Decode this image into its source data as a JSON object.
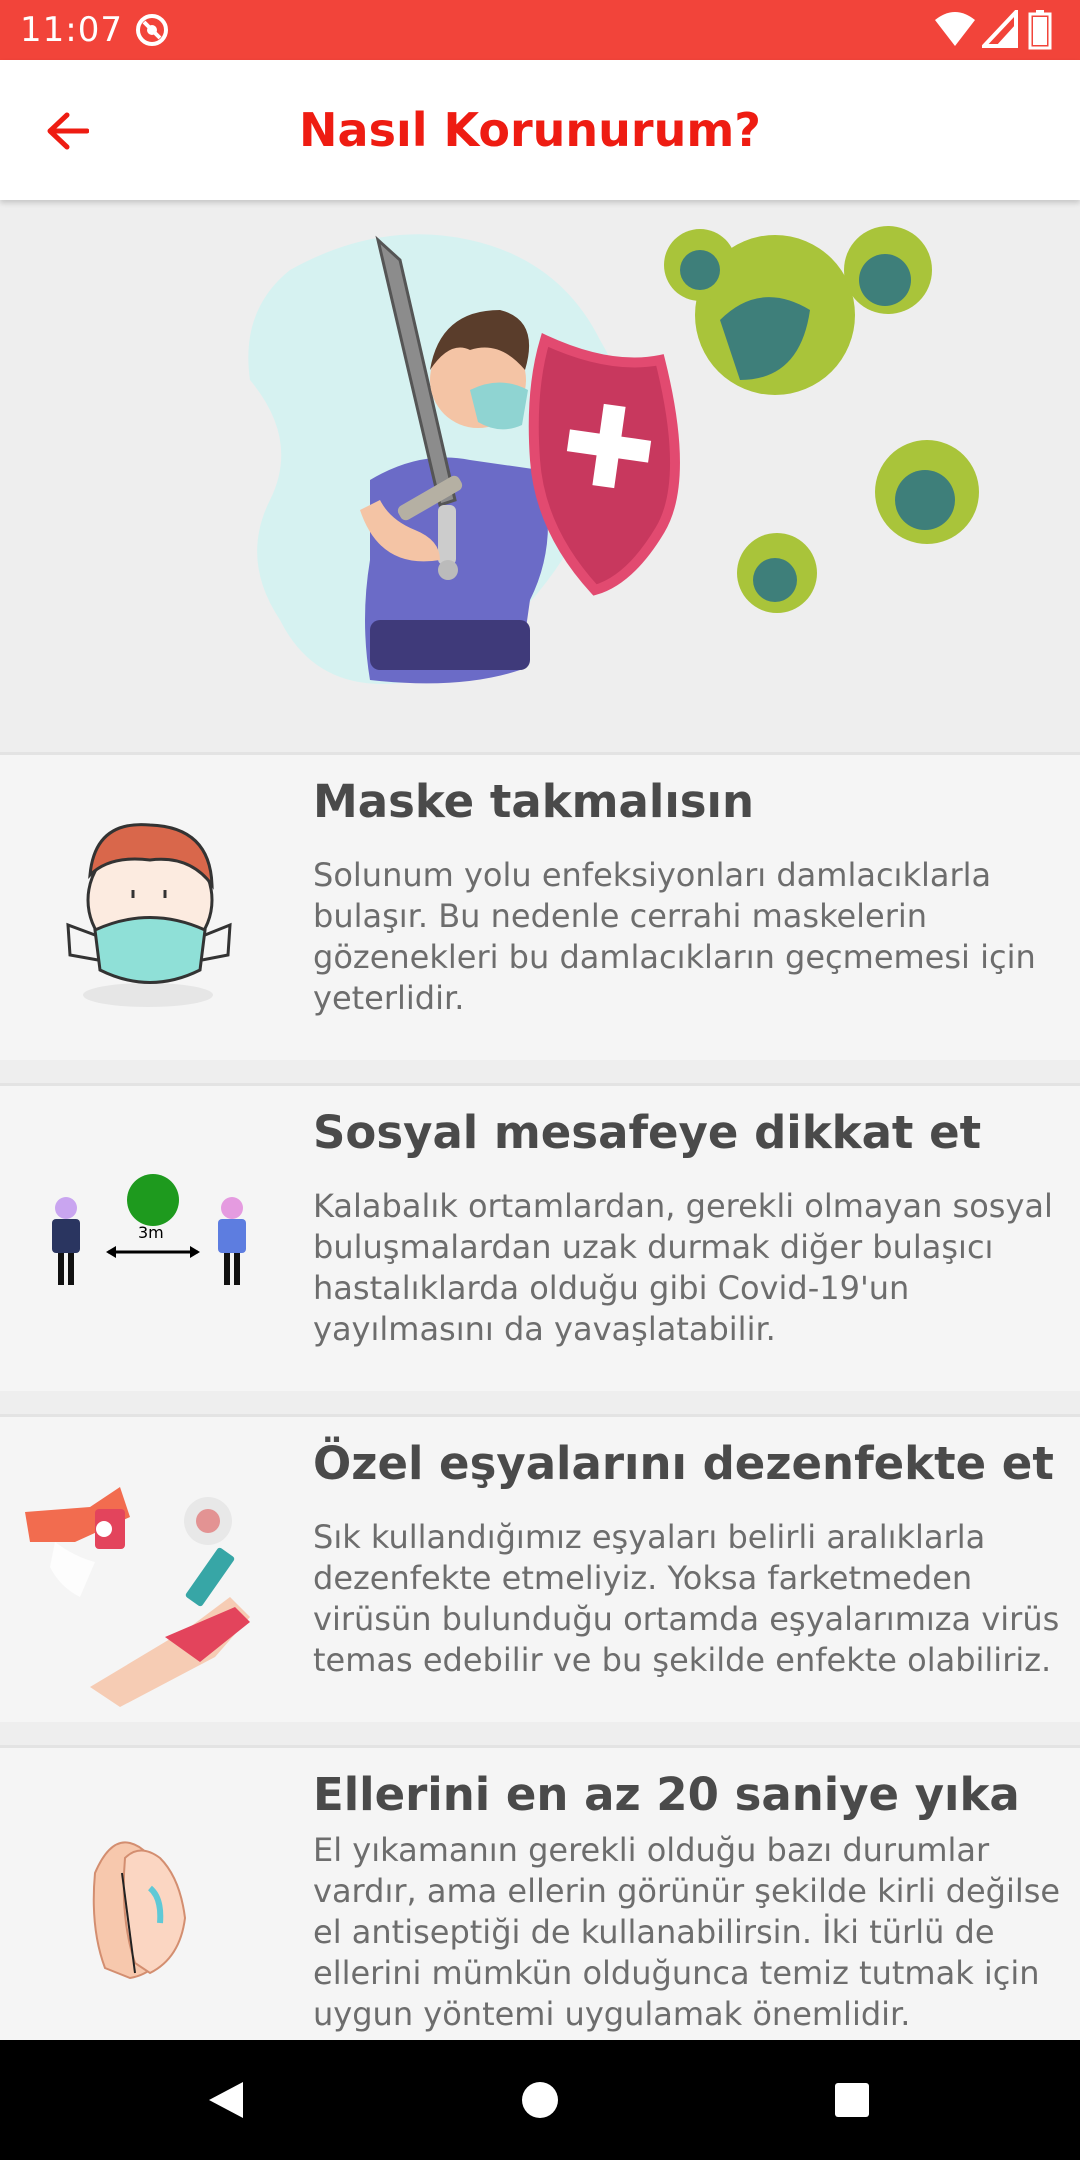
{
  "status_bar": {
    "time": "11:07",
    "sync_icon": "data-saver-icon",
    "right_icons": [
      "wifi-icon",
      "cellular-signal-icon",
      "battery-icon"
    ],
    "color": "#f2443a"
  },
  "app_bar": {
    "title": "Nasıl Korunurum?",
    "back_icon": "arrow-left-icon",
    "accent_color": "#ee1c12"
  },
  "hero": {
    "image": "hero-with-shield-fighting-virus-illustration"
  },
  "tips": [
    {
      "title": "Maske takmalısın",
      "body": "Solunum yolu enfeksiyonları damlacıklarla bulaşır. Bu nedenle cerrahi maskelerin gözenekleri bu damlacıkların geçmemesi için yeterlidir.",
      "image": "face-mask-illustration"
    },
    {
      "title": "Sosyal mesafeye dikkat et",
      "body": "Kalabalık ortamlardan, gerekli olmayan sosyal buluşmalardan uzak durmak diğer bulaşıcı hastalıklarda olduğu gibi Covid-19'un yayılmasını da yavaşlatabilir.",
      "image": "social-distance-illustration",
      "image_label": "3m"
    },
    {
      "title": "Özel eşyalarını dezenfekte et",
      "body": "Sık kullandığımız eşyaları belirli aralıklarla dezenfekte etmeliyiz. Yoksa farketmeden virüsün bulunduğu ortamda eşyalarımıza virüs temas edebilir ve bu şekilde enfekte olabiliriz.",
      "image": "disinfect-phone-illustration"
    },
    {
      "title": "Ellerini en az 20 saniye yıka",
      "body": "El yıkamanın gerekli olduğu bazı durumlar vardır, ama ellerin görünür şekilde kirli değilse el antiseptiği de kullanabilirsin. İki türlü de ellerini mümkün olduğunca temiz tutmak için uygun yöntemi uygulamak önemlidir.",
      "image": "hand-washing-illustration"
    }
  ],
  "nav_bar": {
    "buttons": [
      "back-triangle-icon",
      "home-circle-icon",
      "recents-square-icon"
    ]
  }
}
